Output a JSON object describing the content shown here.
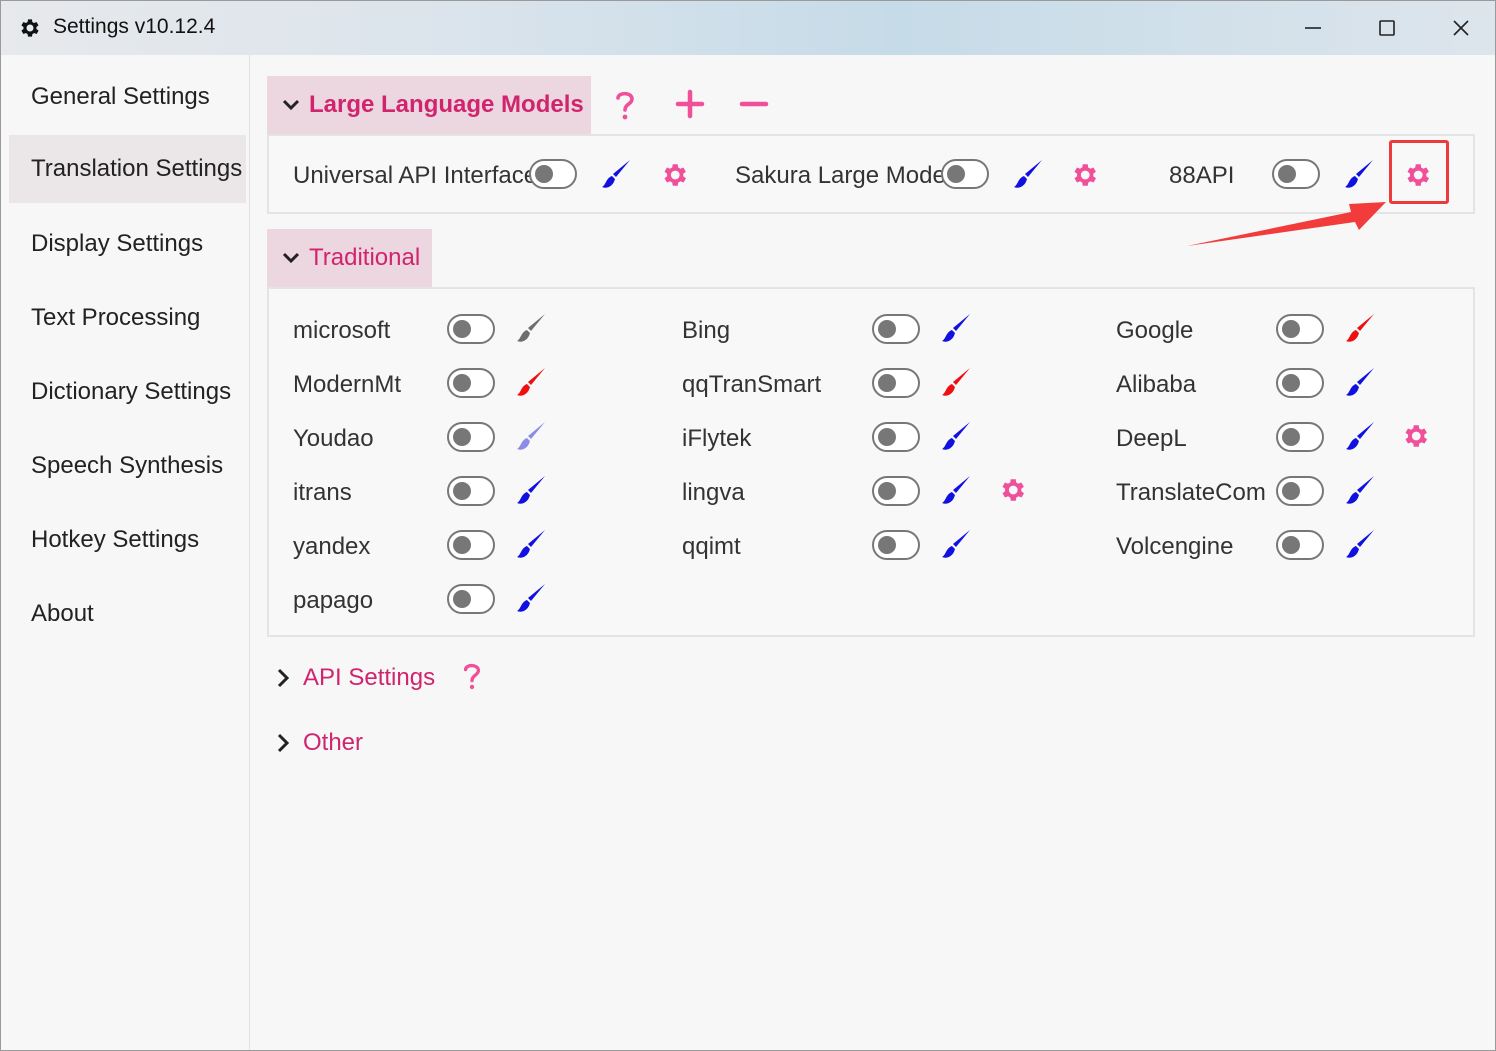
{
  "window": {
    "title": "Settings v10.12.4"
  },
  "sidebar": {
    "items": [
      {
        "label": "General Settings",
        "active": false
      },
      {
        "label": "Translation Settings",
        "active": true
      },
      {
        "label": "Display Settings",
        "active": false
      },
      {
        "label": "Text Processing",
        "active": false
      },
      {
        "label": "Dictionary Settings",
        "active": false
      },
      {
        "label": "Speech Synthesis",
        "active": false
      },
      {
        "label": "Hotkey Settings",
        "active": false
      },
      {
        "label": "About",
        "active": false
      }
    ]
  },
  "llm": {
    "title": "Large Language Models",
    "help_icon": "question-mark-icon",
    "add_icon": "plus-icon",
    "remove_icon": "minus-icon",
    "items": [
      {
        "label": "Universal API Interface",
        "enabled": false,
        "brush_color": "#1010e0",
        "settings": true
      },
      {
        "label": "Sakura Large Model",
        "enabled": false,
        "brush_color": "#1010e0",
        "settings": true
      },
      {
        "label": "88API",
        "enabled": false,
        "brush_color": "#1010e0",
        "settings": true
      }
    ]
  },
  "traditional": {
    "title": "Traditional",
    "items": [
      {
        "label": "microsoft",
        "enabled": false,
        "brush_color": "#6e6e6e",
        "settings": false
      },
      {
        "label": "Bing",
        "enabled": false,
        "brush_color": "#1010e0",
        "settings": false
      },
      {
        "label": "Google",
        "enabled": false,
        "brush_color": "#ee1010",
        "settings": false
      },
      {
        "label": "ModernMt",
        "enabled": false,
        "brush_color": "#ee1010",
        "settings": false
      },
      {
        "label": "qqTranSmart",
        "enabled": false,
        "brush_color": "#ee1010",
        "settings": false
      },
      {
        "label": "Alibaba",
        "enabled": false,
        "brush_color": "#1010e0",
        "settings": false
      },
      {
        "label": "Youdao",
        "enabled": false,
        "brush_color": "#8c8ce8",
        "settings": false
      },
      {
        "label": "iFlytek",
        "enabled": false,
        "brush_color": "#1010e0",
        "settings": false
      },
      {
        "label": "DeepL",
        "enabled": false,
        "brush_color": "#1010e0",
        "settings": true
      },
      {
        "label": "itrans",
        "enabled": false,
        "brush_color": "#1010e0",
        "settings": false
      },
      {
        "label": "lingva",
        "enabled": false,
        "brush_color": "#1010e0",
        "settings": true
      },
      {
        "label": "TranslateCom",
        "enabled": false,
        "brush_color": "#1010e0",
        "settings": false
      },
      {
        "label": "yandex",
        "enabled": false,
        "brush_color": "#1010e0",
        "settings": false
      },
      {
        "label": "qqimt",
        "enabled": false,
        "brush_color": "#1010e0",
        "settings": false
      },
      {
        "label": "Volcengine",
        "enabled": false,
        "brush_color": "#1010e0",
        "settings": false
      },
      {
        "label": "papago",
        "enabled": false,
        "brush_color": "#1010e0",
        "settings": false
      }
    ]
  },
  "api_settings": {
    "title": "API Settings"
  },
  "other": {
    "title": "Other"
  },
  "colors": {
    "accent": "#d0246e",
    "gear": "#f04f9a",
    "section_bg": "#ecd6e0",
    "highlight": "#ee3a3a"
  }
}
